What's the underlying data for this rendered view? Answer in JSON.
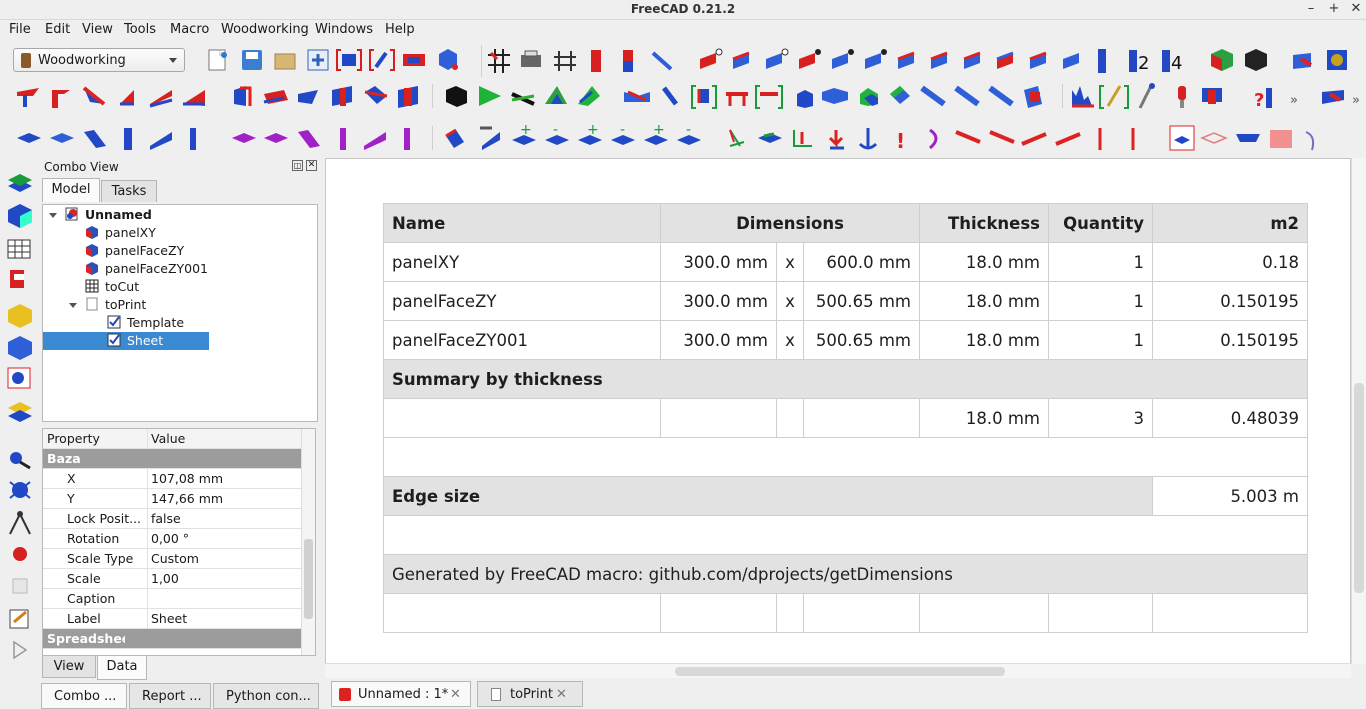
{
  "window": {
    "title": "FreeCAD 0.21.2",
    "min": "–",
    "max": "+",
    "close": "✕"
  },
  "menu": [
    "File",
    "Edit",
    "View",
    "Tools",
    "Macro",
    "Woodworking",
    "Windows",
    "Help"
  ],
  "workbench": "Woodworking",
  "combo": {
    "title": "Combo View",
    "tabs": [
      "Model",
      "Tasks"
    ],
    "tree": [
      {
        "label": "Unnamed",
        "icon": "document-icon"
      },
      {
        "label": "panelXY",
        "icon": "panel-icon"
      },
      {
        "label": "panelFaceZY",
        "icon": "panel-icon"
      },
      {
        "label": "panelFaceZY001",
        "icon": "panel-icon"
      },
      {
        "label": "toCut",
        "icon": "spreadsheet-icon"
      },
      {
        "label": "toPrint",
        "icon": "page-icon"
      },
      {
        "label": "Template",
        "icon": "template-icon"
      },
      {
        "label": "Sheet",
        "icon": "sheet-view-icon"
      }
    ],
    "props_header": {
      "property": "Property",
      "value": "Value"
    },
    "props": [
      {
        "group": "Baza"
      },
      {
        "k": "X",
        "v": "107,08 mm"
      },
      {
        "k": "Y",
        "v": "147,66 mm"
      },
      {
        "k": "Lock Posit...",
        "v": "false"
      },
      {
        "k": "Rotation",
        "v": "0,00 °"
      },
      {
        "k": "Scale Type",
        "v": "Custom"
      },
      {
        "k": "Scale",
        "v": "1,00"
      },
      {
        "k": "Caption",
        "v": ""
      },
      {
        "k": "Label",
        "v": "Sheet"
      },
      {
        "group": "Spreadsheet"
      }
    ],
    "view_tabs": [
      "View",
      "Data"
    ],
    "bottom_tabs": [
      "Combo ...",
      "Report ...",
      "Python con..."
    ]
  },
  "doc_tabs": [
    {
      "label": "Unnamed : 1*",
      "close": "✕"
    },
    {
      "label": "toPrint",
      "close": "✕"
    }
  ],
  "sheet": {
    "header": {
      "name": "Name",
      "dimensions": "Dimensions",
      "thickness": "Thickness",
      "quantity": "Quantity",
      "m2": "m2"
    },
    "rows": [
      {
        "name": "panelXY",
        "d1": "300.0 mm",
        "x": "x",
        "d2": "600.0 mm",
        "t": "18.0 mm",
        "q": "1",
        "m2": "0.18"
      },
      {
        "name": "panelFaceZY",
        "d1": "300.0 mm",
        "x": "x",
        "d2": "500.65 mm",
        "t": "18.0 mm",
        "q": "1",
        "m2": "0.150195"
      },
      {
        "name": "panelFaceZY001",
        "d1": "300.0 mm",
        "x": "x",
        "d2": "500.65 mm",
        "t": "18.0 mm",
        "q": "1",
        "m2": "0.150195"
      }
    ],
    "summary_title": "Summary by thickness",
    "summary": {
      "t": "18.0 mm",
      "q": "3",
      "m2": "0.48039"
    },
    "edge_title": "Edge size",
    "edge_value": "5.003 m",
    "generated": "Generated by FreeCAD macro: github.com/dprojects/getDimensions"
  }
}
